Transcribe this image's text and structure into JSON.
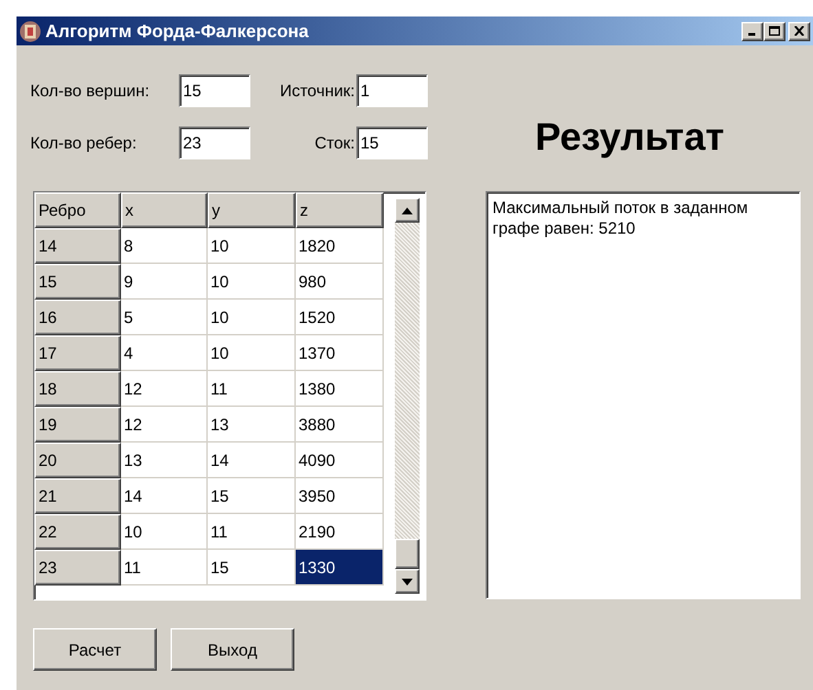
{
  "window": {
    "title": "Алгоритм Форда-Фалкерсона"
  },
  "fields": [
    {
      "label": "Кол-во вершин:",
      "value": "15"
    },
    {
      "label": "Источник:",
      "value": "1"
    },
    {
      "label": "Кол-во ребер:",
      "value": "23"
    },
    {
      "label": "Сток:",
      "value": "15"
    }
  ],
  "result_heading": "Результат",
  "table": {
    "columns": [
      "Ребро",
      "x",
      "y",
      "z"
    ],
    "rows": [
      {
        "cells": [
          {
            "text": "14",
            "selected": false
          },
          {
            "text": "8",
            "selected": false
          },
          {
            "text": "10",
            "selected": false
          },
          {
            "text": "1820",
            "selected": false
          }
        ]
      },
      {
        "cells": [
          {
            "text": "15",
            "selected": false
          },
          {
            "text": "9",
            "selected": false
          },
          {
            "text": "10",
            "selected": false
          },
          {
            "text": "980",
            "selected": false
          }
        ]
      },
      {
        "cells": [
          {
            "text": "16",
            "selected": false
          },
          {
            "text": "5",
            "selected": false
          },
          {
            "text": "10",
            "selected": false
          },
          {
            "text": "1520",
            "selected": false
          }
        ]
      },
      {
        "cells": [
          {
            "text": "17",
            "selected": false
          },
          {
            "text": "4",
            "selected": false
          },
          {
            "text": "10",
            "selected": false
          },
          {
            "text": "1370",
            "selected": false
          }
        ]
      },
      {
        "cells": [
          {
            "text": "18",
            "selected": false
          },
          {
            "text": "12",
            "selected": false
          },
          {
            "text": "11",
            "selected": false
          },
          {
            "text": "1380",
            "selected": false
          }
        ]
      },
      {
        "cells": [
          {
            "text": "19",
            "selected": false
          },
          {
            "text": "12",
            "selected": false
          },
          {
            "text": "13",
            "selected": false
          },
          {
            "text": "3880",
            "selected": false
          }
        ]
      },
      {
        "cells": [
          {
            "text": "20",
            "selected": false
          },
          {
            "text": "13",
            "selected": false
          },
          {
            "text": "14",
            "selected": false
          },
          {
            "text": "4090",
            "selected": false
          }
        ]
      },
      {
        "cells": [
          {
            "text": "21",
            "selected": false
          },
          {
            "text": "14",
            "selected": false
          },
          {
            "text": "15",
            "selected": false
          },
          {
            "text": "3950",
            "selected": false
          }
        ]
      },
      {
        "cells": [
          {
            "text": "22",
            "selected": false
          },
          {
            "text": "10",
            "selected": false
          },
          {
            "text": "11",
            "selected": false
          },
          {
            "text": "2190",
            "selected": false
          }
        ]
      },
      {
        "cells": [
          {
            "text": "23",
            "selected": false
          },
          {
            "text": "11",
            "selected": false
          },
          {
            "text": "15",
            "selected": false
          },
          {
            "text": "1330",
            "selected": true
          }
        ]
      }
    ]
  },
  "result_text": "Максимальный поток в заданном графе равен: 5210",
  "buttons": [
    "Расчет",
    "Выход"
  ]
}
